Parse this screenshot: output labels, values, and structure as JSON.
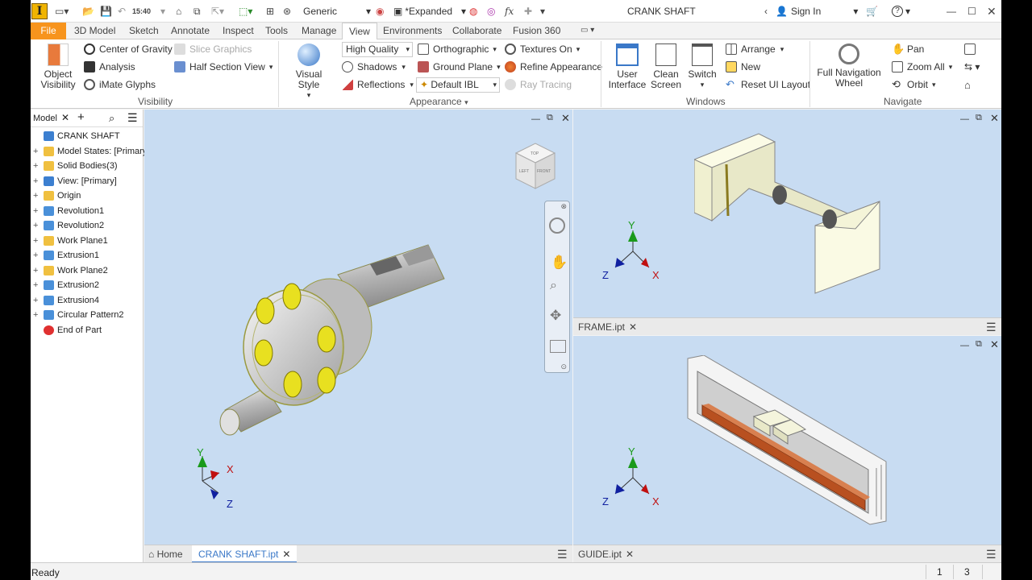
{
  "app": {
    "title": "CRANK SHAFT",
    "logo": "I"
  },
  "qat": {
    "time": "15:40",
    "appearance": "Generic",
    "expanded": "*Expanded",
    "sign_in": "Sign In",
    "help": "?"
  },
  "tabs": [
    "File",
    "3D Model",
    "Sketch",
    "Annotate",
    "Inspect",
    "Tools",
    "Manage",
    "View",
    "Environments",
    "Collaborate",
    "Fusion 360"
  ],
  "active_tab": "View",
  "ribbon": {
    "visibility": {
      "object_visibility": "Object\nVisibility",
      "center_of_gravity": "Center of Gravity",
      "slice_graphics": "Slice Graphics",
      "analysis": "Analysis",
      "half_section": "Half Section View",
      "imate_glyphs": "iMate Glyphs",
      "label": "Visibility"
    },
    "appearance": {
      "visual_style": "Visual Style",
      "quality": "High Quality",
      "shadows": "Shadows",
      "reflections": "Reflections",
      "orthographic": "Orthographic",
      "ground_plane": "Ground Plane",
      "default_ibl": "Default IBL",
      "textures_on": "Textures On",
      "refine_appearance": "Refine Appearance",
      "ray_tracing": "Ray Tracing",
      "label": "Appearance"
    },
    "windows": {
      "user_interface": "User\nInterface",
      "clean_screen": "Clean\nScreen",
      "switch": "Switch",
      "arrange": "Arrange",
      "new": "New",
      "reset_ui": "Reset UI Layout",
      "label": "Windows"
    },
    "navigate": {
      "full_nav_wheel": "Full Navigation\nWheel",
      "pan": "Pan",
      "zoom_all": "Zoom All",
      "orbit": "Orbit",
      "label": "Navigate"
    }
  },
  "browser": {
    "tab": "Model",
    "items": [
      {
        "label": "CRANK SHAFT",
        "icon": "part-icon",
        "color": "#3c7fd0"
      },
      {
        "label": "Model States: [Primary]",
        "icon": "folder-icon",
        "color": "#f0c040"
      },
      {
        "label": "Solid Bodies(3)",
        "icon": "folder-icon",
        "color": "#f0c040"
      },
      {
        "label": "View: [Primary]",
        "icon": "view-icon",
        "color": "#3c7fd0"
      },
      {
        "label": "Origin",
        "icon": "folder-icon",
        "color": "#f0c040"
      },
      {
        "label": "Revolution1",
        "icon": "revolve-icon",
        "color": "#4a90d9"
      },
      {
        "label": "Revolution2",
        "icon": "revolve-icon",
        "color": "#4a90d9"
      },
      {
        "label": "Work Plane1",
        "icon": "workplane-icon",
        "color": "#f0c040"
      },
      {
        "label": "Extrusion1",
        "icon": "extrude-icon",
        "color": "#4a90d9"
      },
      {
        "label": "Work Plane2",
        "icon": "workplane-icon",
        "color": "#f0c040"
      },
      {
        "label": "Extrusion2",
        "icon": "extrude-icon",
        "color": "#4a90d9"
      },
      {
        "label": "Extrusion4",
        "icon": "extrude-icon",
        "color": "#4a90d9"
      },
      {
        "label": "Circular Pattern2",
        "icon": "pattern-icon",
        "color": "#4a90d9"
      },
      {
        "label": "End of Part",
        "icon": "end-icon",
        "color": "#e03030"
      }
    ]
  },
  "viewcube": {
    "top": "TOP",
    "left": "LEFT",
    "front": "FRONT"
  },
  "docs": {
    "home": "Home",
    "crank": "CRANK SHAFT.ipt",
    "frame": "FRAME.ipt",
    "guide": "GUIDE.ipt"
  },
  "axes": {
    "x": "X",
    "y": "Y",
    "z": "Z"
  },
  "status": {
    "text": "Ready",
    "n1": "1",
    "n2": "3"
  }
}
